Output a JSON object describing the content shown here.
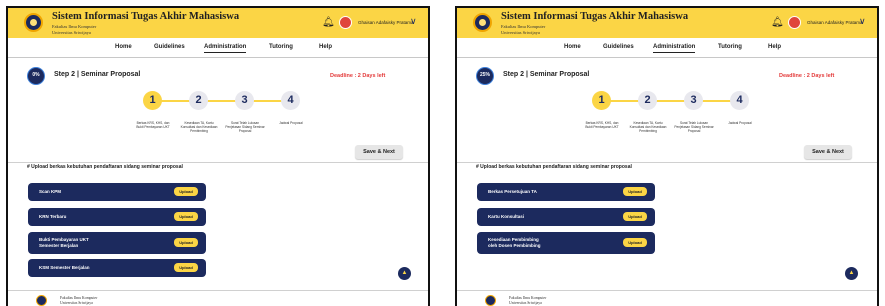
{
  "header": {
    "title": "Sistem Informasi Tugas Akhir Mahasiswa",
    "subtitle_line1": "Fakultas Ilmu Komputer",
    "subtitle_line2": "Universitas Sriwijaya",
    "username": "Ghaisan Adafaisky Pratama",
    "icons": [
      "logo-icon",
      "bell-icon",
      "avatar",
      "chevron-down-icon"
    ]
  },
  "nav": {
    "items": [
      "Home",
      "Guidelines",
      "Administration",
      "Tutoring",
      "Help"
    ],
    "active": "Administration"
  },
  "step_title": "Step 2 | Seminar Proposal",
  "deadline": "Deadline : 2 Days left",
  "save_label": "Save & Next",
  "upload_title": "# Upload berkas kebutuhan pendaftaran sidang seminar proposal",
  "steps": [
    {
      "num": "1",
      "label": "Berkas KRS, KHS, dan Bukti Pembayaran UKT"
    },
    {
      "num": "2",
      "label": "Kesediaan TA, Kartu Konsultasi dan Kesediaan Pembimbing"
    },
    {
      "num": "3",
      "label": "Surat Telah Lulusan Penjelasan Sidang Seminar Proposal"
    },
    {
      "num": "4",
      "label": "Jadwal Proposal"
    }
  ],
  "panels": [
    {
      "progress": "0%",
      "active_step": 1,
      "documents": [
        {
          "name": "Scan KPM",
          "action": "Upload"
        },
        {
          "name": "KRN Terbaru",
          "action": "Upload"
        },
        {
          "name": "Bukti Pembayaran UKT",
          "name2": "Semester Berjalan",
          "action": "Upload"
        },
        {
          "name": "KSM Semester Berjalan",
          "action": "Upload"
        }
      ]
    },
    {
      "progress": "25%",
      "active_step": 1,
      "documents": [
        {
          "name": "Berkas Persetujuan TA",
          "action": "Upload"
        },
        {
          "name": "Kartu Konsultasi",
          "action": "Upload"
        },
        {
          "name": "Kesediaan Pembimbing",
          "name2": "oleh Dosen Pembimbing",
          "action": "Upload"
        }
      ]
    }
  ],
  "footer": {
    "line1": "Fakultas Ilmu Komputer",
    "line2": "Universitas Sriwijaya"
  },
  "colors": {
    "header_bg": "#fbd545",
    "navy": "#1c2a5e",
    "deadline": "#e33a3a",
    "upload_btn": "#fbd545"
  }
}
